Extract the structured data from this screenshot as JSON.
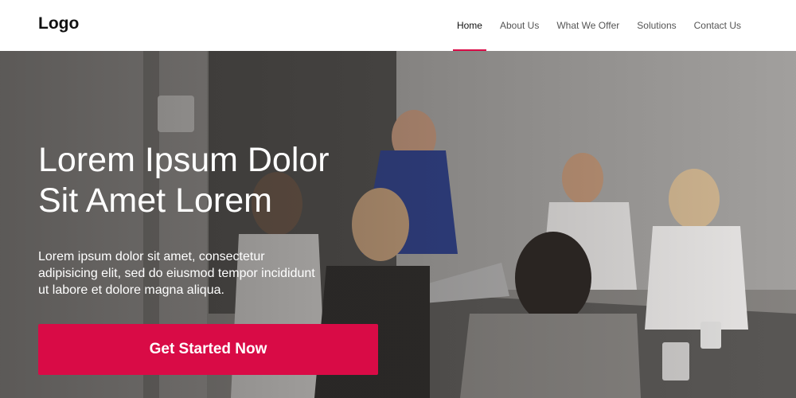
{
  "header": {
    "logo": "Logo",
    "nav": [
      {
        "label": "Home",
        "active": true
      },
      {
        "label": "About Us",
        "active": false
      },
      {
        "label": "What We Offer",
        "active": false
      },
      {
        "label": "Solutions",
        "active": false
      },
      {
        "label": "Contact Us",
        "active": false
      }
    ]
  },
  "hero": {
    "title_line1": "Lorem Ipsum Dolor",
    "title_line2": "Sit Amet Lorem",
    "text_line1": "Lorem ipsum dolor sit amet, consectetur",
    "text_line2": "adipisicing elit, sed do eiusmod tempor incididunt",
    "text_line3": "ut labore et dolore magna aliqua.",
    "cta_label": "Get Started Now",
    "image": "office-meeting-photo"
  },
  "colors": {
    "accent": "#d90b46",
    "header_bg": "#ffffff",
    "hero_text": "#ffffff"
  }
}
